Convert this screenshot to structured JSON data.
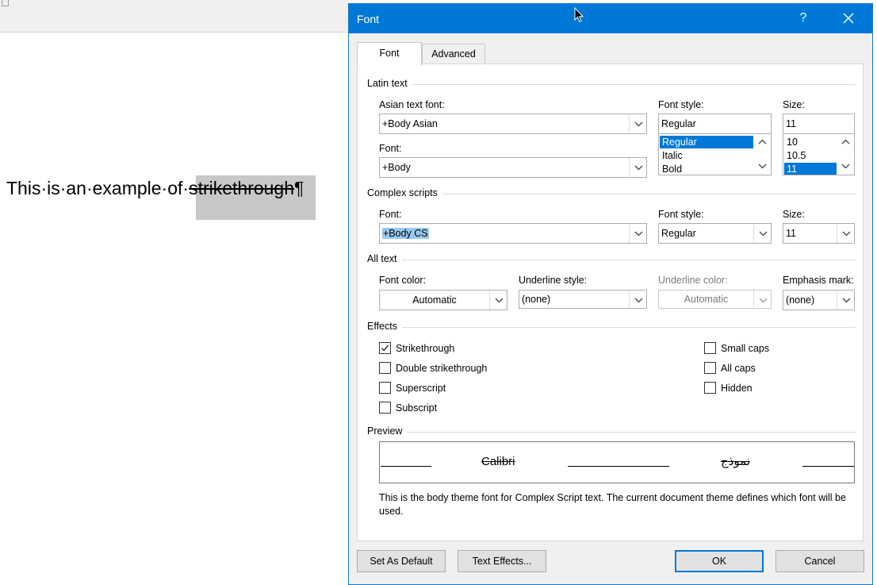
{
  "document": {
    "text_before": "This·is·an·example·of·",
    "text_selected": "strikethrough",
    "pilcrow": "¶"
  },
  "dialog": {
    "title": "Font",
    "help_label": "?",
    "tabs": [
      {
        "label": "Font",
        "active": true
      },
      {
        "label": "Advanced",
        "active": false
      }
    ],
    "latin": {
      "section": "Latin text",
      "asian_font_label": "Asian text font:",
      "asian_font_value": "+Body Asian",
      "font_label": "Font:",
      "font_value": "+Body",
      "style_label": "Font style:",
      "style_value": "Regular",
      "style_options": [
        "Regular",
        "Italic",
        "Bold"
      ],
      "size_label": "Size:",
      "size_value": "11",
      "size_options": [
        "10",
        "10.5",
        "11"
      ]
    },
    "complex": {
      "section": "Complex scripts",
      "font_label": "Font:",
      "font_value": "+Body CS",
      "style_label": "Font style:",
      "style_value": "Regular",
      "size_label": "Size:",
      "size_value": "11"
    },
    "all_text": {
      "section": "All text",
      "color_label": "Font color:",
      "color_value": "Automatic",
      "underline_label": "Underline style:",
      "underline_value": "(none)",
      "underline_color_label": "Underline color:",
      "underline_color_value": "Automatic",
      "emphasis_label": "Emphasis mark:",
      "emphasis_value": "(none)"
    },
    "effects": {
      "section": "Effects",
      "items": [
        {
          "label": "Strikethrough",
          "checked": true
        },
        {
          "label": "Double strikethrough",
          "checked": false
        },
        {
          "label": "Superscript",
          "checked": false
        },
        {
          "label": "Subscript",
          "checked": false
        },
        {
          "label": "Small caps",
          "checked": false
        },
        {
          "label": "All caps",
          "checked": false
        },
        {
          "label": "Hidden",
          "checked": false
        }
      ]
    },
    "preview": {
      "section": "Preview",
      "latin_sample": "Calibri",
      "complex_sample": "نموذج",
      "description": "This is the body theme font for Complex Script text. The current document theme defines which font will be used."
    },
    "buttons": {
      "set_default": "Set As Default",
      "text_effects": "Text Effects...",
      "ok": "OK",
      "cancel": "Cancel"
    }
  },
  "colors": {
    "titlebar": "#0078d7",
    "selection": "#0078d7",
    "text_highlight": "#99c9ef"
  }
}
